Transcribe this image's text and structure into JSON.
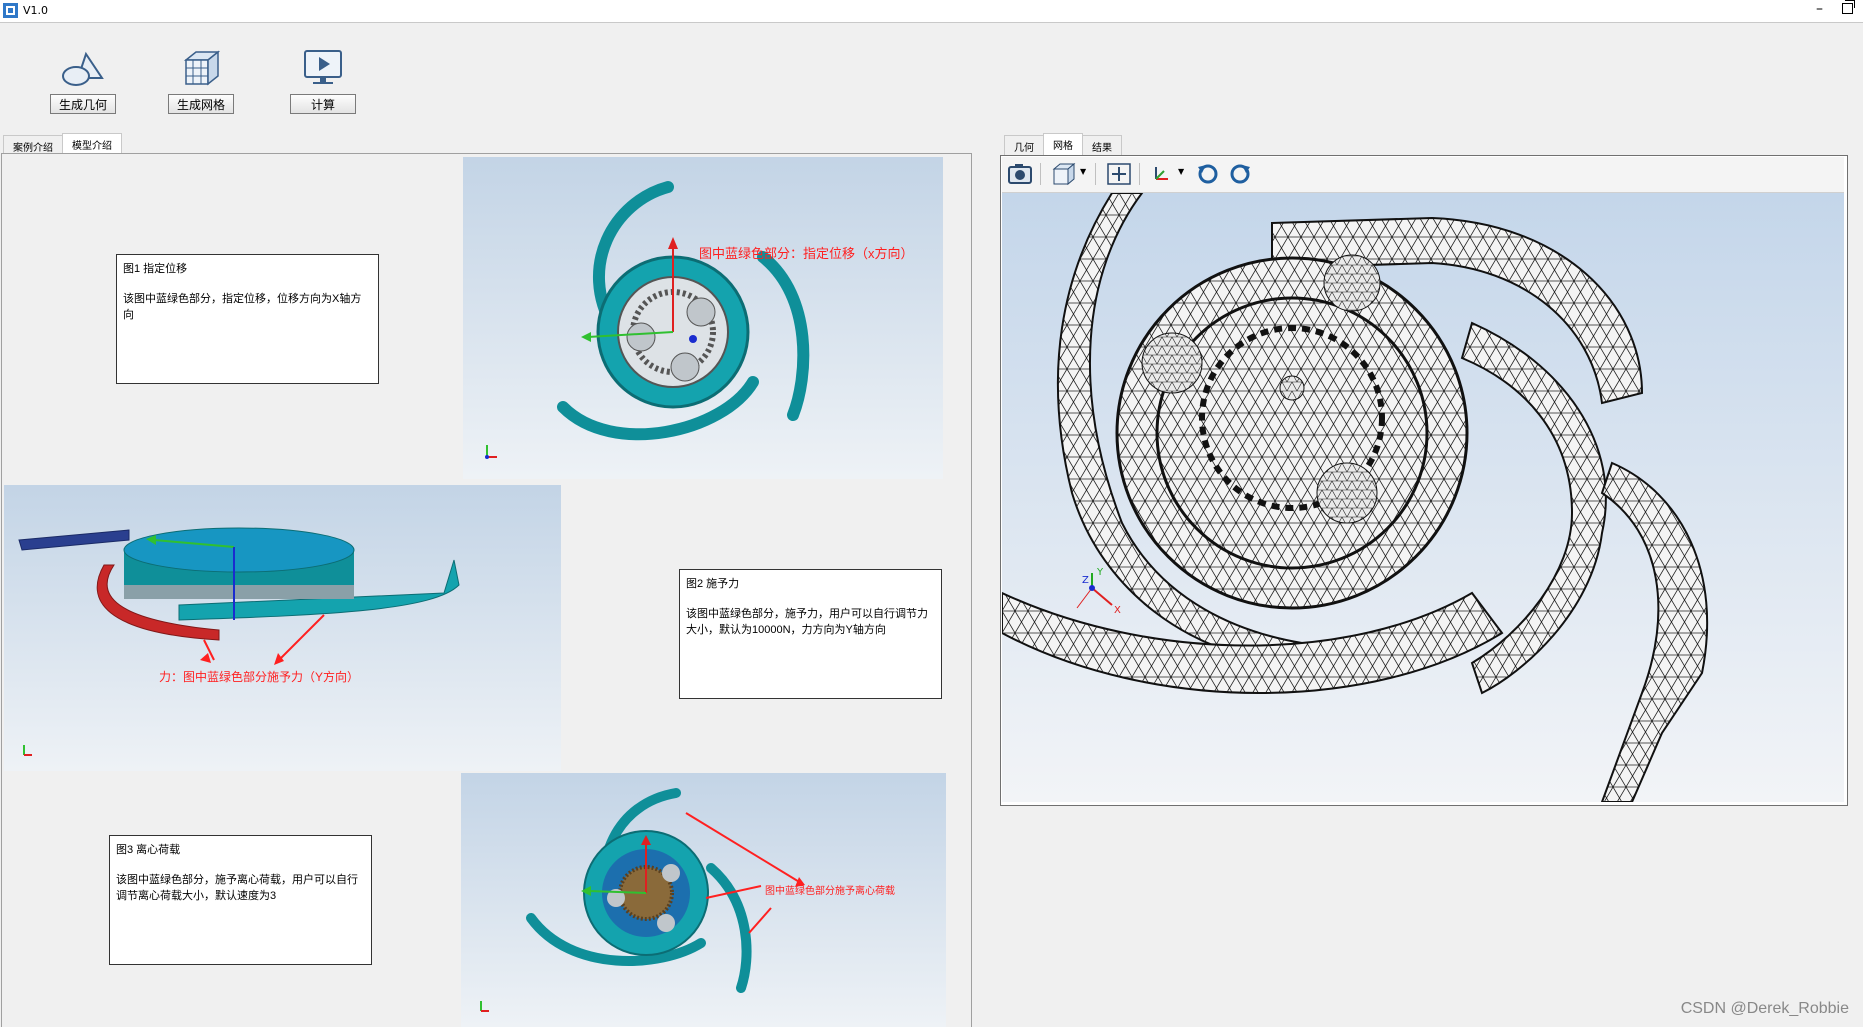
{
  "window": {
    "title": "V1.0"
  },
  "toolbar": {
    "geometry_label": "生成几何",
    "mesh_label": "生成网格",
    "compute_label": "计算"
  },
  "left_tabs": [
    "案例介绍",
    "模型介绍"
  ],
  "right_tabs": [
    "几何",
    "网格",
    "结果"
  ],
  "figures": {
    "fig1": {
      "title": "图1 指定位移",
      "body": "该图中蓝绿色部分，指定位移，位移方向为X轴方向",
      "annotation": "图中蓝绿色部分：指定位移（x方向）"
    },
    "fig2": {
      "title": "图2 施予力",
      "body": "该图中蓝绿色部分，施予力，用户可以自行调节力大小，默认为10000N，力方向为Y轴方向",
      "annotation": "力：图中蓝绿色部分施予力（Y方向）"
    },
    "fig3": {
      "title": "图3 离心荷载",
      "body": "该图中蓝绿色部分，施予离心荷载，用户可以自行调节离心荷载大小，默认速度为3",
      "annotation": "图中蓝绿色部分施予离心荷载"
    }
  },
  "triad": {
    "x": "X",
    "y": "Y",
    "z": "Z"
  },
  "watermark": "CSDN @Derek_Robbie",
  "colors": {
    "teal": "#13a9b5",
    "annotation": "#ff2020",
    "mesh_bg_top": "#c4d6ea"
  },
  "icons": [
    "geometry-icon",
    "mesh-icon",
    "compute-icon",
    "camera-icon",
    "view-cube-icon",
    "fit-view-icon",
    "axis-triad-icon",
    "rotate-ccw-icon",
    "rotate-cw-icon"
  ]
}
